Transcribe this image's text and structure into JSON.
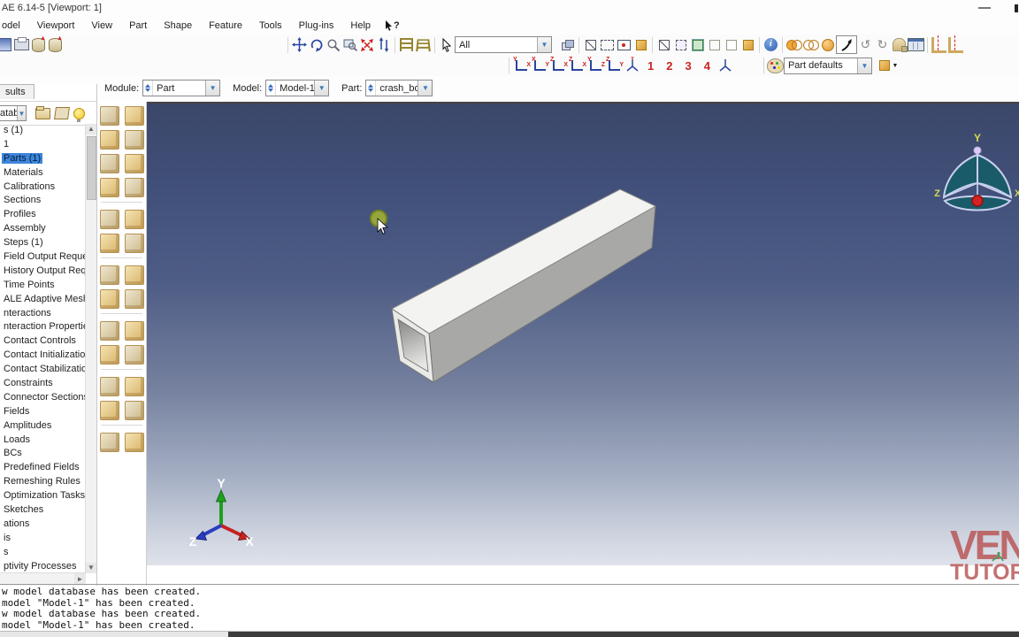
{
  "window": {
    "title": "AE 6.14-5 [Viewport: 1]"
  },
  "menubar": {
    "items": [
      "odel",
      "Viewport",
      "View",
      "Part",
      "Shape",
      "Feature",
      "Tools",
      "Plug-ins",
      "Help"
    ],
    "help_cursor": "?"
  },
  "toolbar": {
    "selection_filter": "All",
    "visibility_combo": "Part defaults"
  },
  "toolbar2": {
    "axis_buttons": [
      [
        "Y",
        "X"
      ],
      [
        "X",
        "Y"
      ],
      [
        "Z",
        "X"
      ],
      [
        "Z",
        "X"
      ],
      [
        "Y",
        "Z"
      ],
      [
        "Z",
        "Y"
      ]
    ],
    "view_numbers": [
      "1",
      "2",
      "3",
      "4"
    ]
  },
  "contextbar": {
    "module_label": "Module:",
    "module_value": "Part",
    "model_label": "Model:",
    "model_value": "Model-1",
    "part_label": "Part:",
    "part_value": "crash_box"
  },
  "sidebar": {
    "tab": "sults",
    "database_combo": "ataba",
    "selected": "Parts (1)",
    "tree": [
      "s (1)",
      "1",
      "Parts (1)",
      "Materials",
      "Calibrations",
      "Sections",
      "Profiles",
      "Assembly",
      "Steps (1)",
      "Field Output Requests",
      "History Output Reque",
      "Time Points",
      "ALE Adaptive Mesh C",
      "nteractions",
      "nteraction Properties",
      "Contact Controls",
      "Contact Initializations",
      "Contact Stabilizations",
      "Constraints",
      "Connector Sections",
      "Fields",
      "Amplitudes",
      "Loads",
      "BCs",
      "Predefined Fields",
      "Remeshing Rules",
      "Optimization Tasks",
      "Sketches",
      "ations",
      "is",
      "s",
      "ptivity Processes"
    ]
  },
  "toolbox": {
    "columns": 2,
    "rows": 13,
    "separators_after_row": [
      4,
      6,
      8,
      10,
      12
    ]
  },
  "viewport": {
    "compass": {
      "x": "X",
      "y": "Y",
      "z": "Z"
    },
    "triad": {
      "x": "X",
      "y": "Y",
      "z": "Z"
    }
  },
  "messages": {
    "lines": [
      "w model database has been created.",
      "model \"Model-1\" has been created.",
      "w model database has been created.",
      "model \"Model-1\" has been created."
    ]
  },
  "watermark": {
    "line1": "VEN",
    "line2": "TUTOR"
  },
  "colors": {
    "selection": "#3c86dc",
    "vp-top": "#3b4769",
    "vp-bottom": "#dfe2ea",
    "watermark": "#b95252",
    "axis-x": "#cc2222",
    "axis-y": "#22a022",
    "axis-z": "#2a3cc0"
  }
}
